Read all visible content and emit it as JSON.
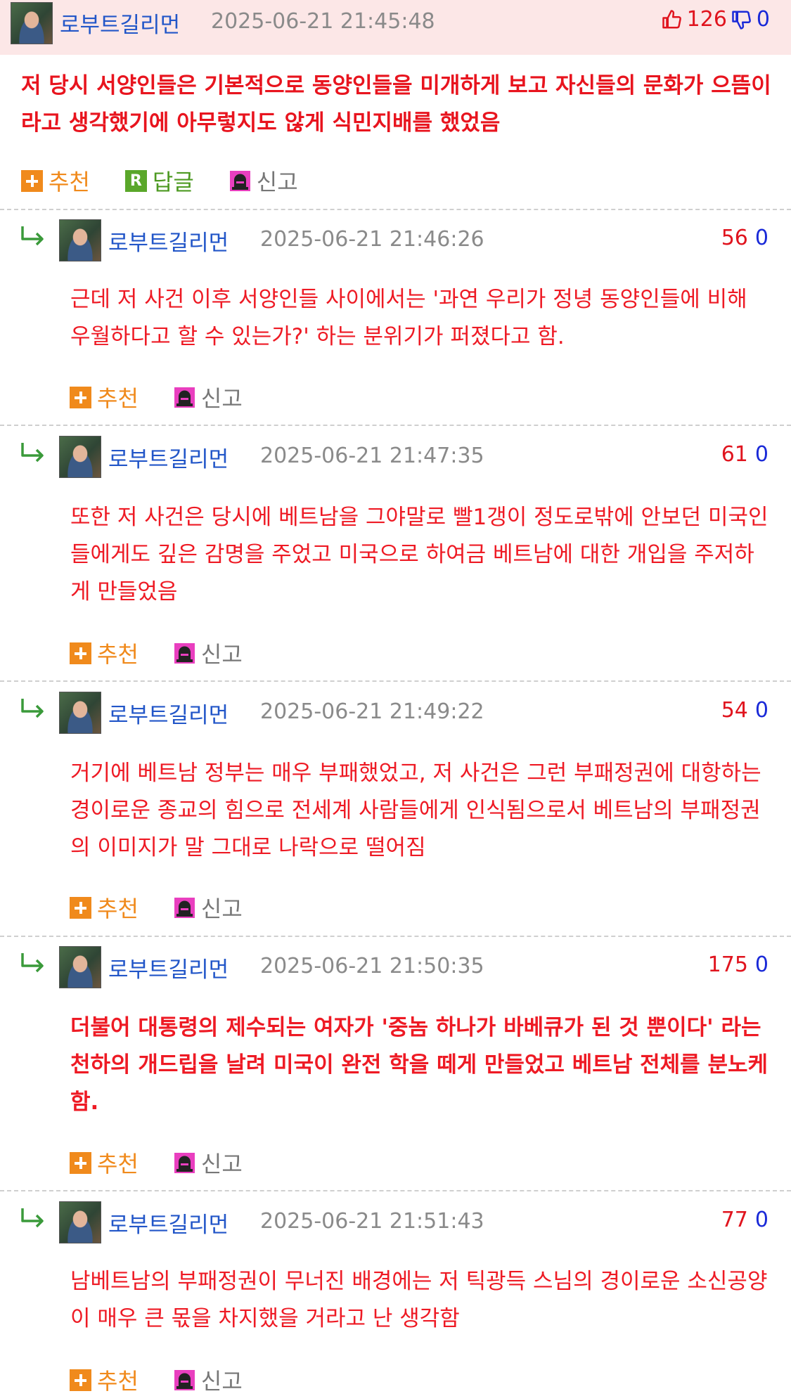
{
  "main": {
    "username": "로부트길리먼",
    "date": "2025-06-21 21:45:48",
    "upvotes": "126",
    "downvotes": "0",
    "text": "저 당시 서양인들은 기본적으로 동양인들을 미개하게 보고 자신들의 문화가 으뜸이라고 생각했기에 아무렇지도 않게 식민지배를 했었음",
    "actions": {
      "recommend": "추천",
      "reply": "답글",
      "report": "신고"
    }
  },
  "actions": {
    "recommend": "추천",
    "report": "신고"
  },
  "replies": [
    {
      "username": "로부트길리먼",
      "date": "2025-06-21 21:46:26",
      "upvotes": "56",
      "downvotes": "0",
      "bold": false,
      "text": "근데 저 사건 이후 서양인들 사이에서는 '과연 우리가 정녕 동양인들에 비해 우월하다고 할 수 있는가?' 하는 분위기가 퍼졌다고 함."
    },
    {
      "username": "로부트길리먼",
      "date": "2025-06-21 21:47:35",
      "upvotes": "61",
      "downvotes": "0",
      "bold": false,
      "text": "또한 저 사건은 당시에 베트남을 그야말로 빨1갱이 정도로밖에 안보던 미국인들에게도 깊은 감명을 주었고 미국으로 하여금 베트남에 대한 개입을 주저하게 만들었음"
    },
    {
      "username": "로부트길리먼",
      "date": "2025-06-21 21:49:22",
      "upvotes": "54",
      "downvotes": "0",
      "bold": false,
      "text": "거기에 베트남 정부는 매우 부패했었고, 저 사건은 그런 부패정권에 대항하는 경이로운 종교의 힘으로 전세계 사람들에게 인식됨으로서 베트남의 부패정권의 이미지가 말 그대로 나락으로 떨어짐"
    },
    {
      "username": "로부트길리먼",
      "date": "2025-06-21 21:50:35",
      "upvotes": "175",
      "downvotes": "0",
      "bold": true,
      "text": "더불어 대통령의 제수되는 여자가 '중놈 하나가 바베큐가 된 것 뿐이다' 라는 천하의 개드립을 날려 미국이 완전 학을 떼게 만들었고 베트남 전체를 분노케함."
    },
    {
      "username": "로부트길리먼",
      "date": "2025-06-21 21:51:43",
      "upvotes": "77",
      "downvotes": "0",
      "bold": false,
      "text": "남베트남의 부패정권이 무너진 배경에는 저 틱광득 스님의 경이로운 소신공양이 매우 큰 몫을 차지했을 거라고 난 생각함"
    }
  ],
  "colors": {
    "header_bg": "#fce7e7",
    "username": "#2256c8",
    "comment_text": "#e8141e",
    "upvote": "#e0141e",
    "downvote": "#1a2ad8",
    "recommend": "#f08a1c",
    "reply_green": "#5aa72a",
    "report_pink": "#e93fbf"
  },
  "icons": {
    "upvote": "thumbs-up-icon",
    "downvote": "thumbs-down-icon",
    "recommend": "plus-icon",
    "reply": "r-icon",
    "report": "siren-icon",
    "reply_indent": "reply-arrow-icon"
  }
}
